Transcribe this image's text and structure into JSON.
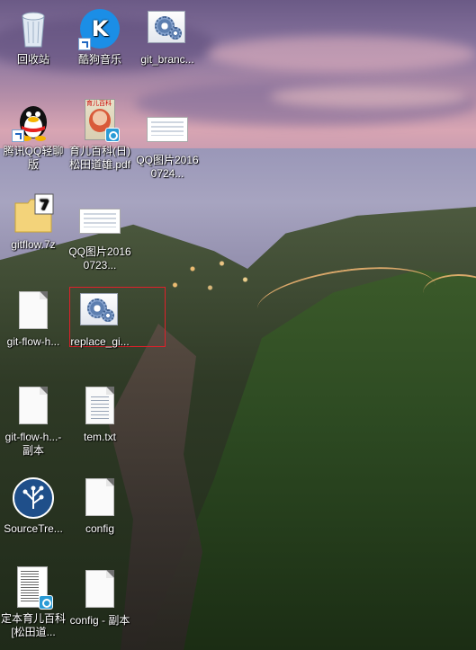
{
  "desktop": {
    "icons": [
      {
        "label": "回收站",
        "icon": "recycle-bin-icon"
      },
      {
        "label": "酷狗音乐",
        "icon": "kugou-music-icon"
      },
      {
        "label": "git_branc...",
        "icon": "config-gear-file-icon"
      },
      {
        "label": "腾讯QQ轻聊版",
        "icon": "qq-penguin-icon"
      },
      {
        "label": "育儿百科(日)松田道雄.pdf",
        "icon": "pdf-book-icon"
      },
      {
        "label": "QQ图片20160724...",
        "icon": "image-file-icon"
      },
      {
        "label": "gitflow.7z",
        "icon": "7z-archive-icon"
      },
      {
        "label": "QQ图片20160723...",
        "icon": "image-file-icon"
      },
      {
        "label": "git-flow-h...",
        "icon": "blank-file-icon"
      },
      {
        "label": "replace_gi...",
        "icon": "config-gear-file-icon"
      },
      {
        "label": "git-flow-h...- 副本",
        "icon": "blank-file-icon"
      },
      {
        "label": "tem.txt",
        "icon": "text-file-icon"
      },
      {
        "label": "SourceTre...",
        "icon": "sourcetree-icon"
      },
      {
        "label": "config",
        "icon": "blank-file-icon"
      },
      {
        "label": "定本育儿百科[松田道...",
        "icon": "pdf-document-icon"
      },
      {
        "label": "config - 副本",
        "icon": "blank-file-icon"
      }
    ],
    "selected": "replace_gi..."
  }
}
